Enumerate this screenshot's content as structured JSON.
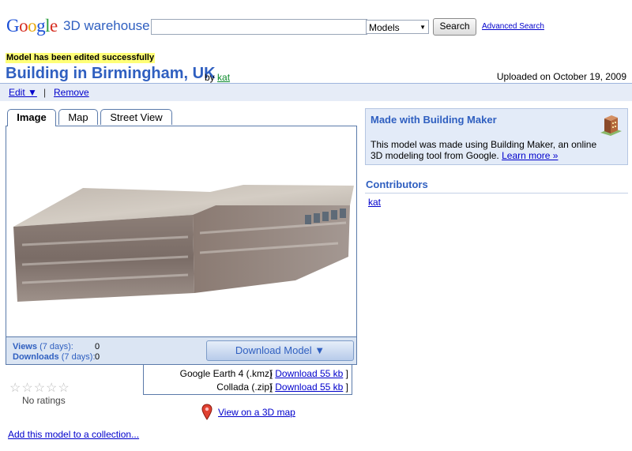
{
  "header": {
    "logo_letters": [
      "G",
      "o",
      "o",
      "g",
      "l",
      "e"
    ],
    "logo_sub": "3D warehouse",
    "search_value": "",
    "search_scope": "Models",
    "search_button": "Search",
    "advanced_search": "Advanced Search"
  },
  "notice": "Model has been edited successfully",
  "model": {
    "title": "Building in Birmingham, UK",
    "by_label": "by",
    "author": "kat",
    "uploaded": "Uploaded on October 19, 2009"
  },
  "actions": {
    "edit": "Edit ▼",
    "separator": "|",
    "remove": "Remove"
  },
  "tabs": [
    {
      "label": "Image",
      "active": true
    },
    {
      "label": "Map",
      "active": false
    },
    {
      "label": "Street View",
      "active": false
    }
  ],
  "stats": {
    "views_label": "Views",
    "views_period": "(7 days):",
    "views_value": "0",
    "downloads_label": "Downloads",
    "downloads_period": "(7 days):",
    "downloads_value": "0"
  },
  "download": {
    "button": "Download Model ▼",
    "options": [
      {
        "format": "Google Earth 4 (.kmz)",
        "open": "[",
        "link": "Download 55 kb",
        "close": "]"
      },
      {
        "format": "Collada (.zip)",
        "open": "[",
        "link": "Download 55 kb",
        "close": "]"
      }
    ]
  },
  "rating": {
    "stars": "☆☆☆☆☆",
    "filled": 0,
    "text": "No ratings"
  },
  "view_on_map": "View on a 3D map",
  "add_to_collection": "Add this model to a collection...",
  "building_maker": {
    "title": "Made with Building Maker",
    "body": "This model was made using Building Maker, an online 3D modeling tool from Google.",
    "learn_more": "Learn more »"
  },
  "contributors": {
    "title": "Contributors",
    "items": [
      "kat"
    ]
  },
  "colors": {
    "accent": "#2f5fc0",
    "link": "#0000cc",
    "notice_bg": "#ffff77",
    "panel_bg": "#e3ebf8"
  }
}
